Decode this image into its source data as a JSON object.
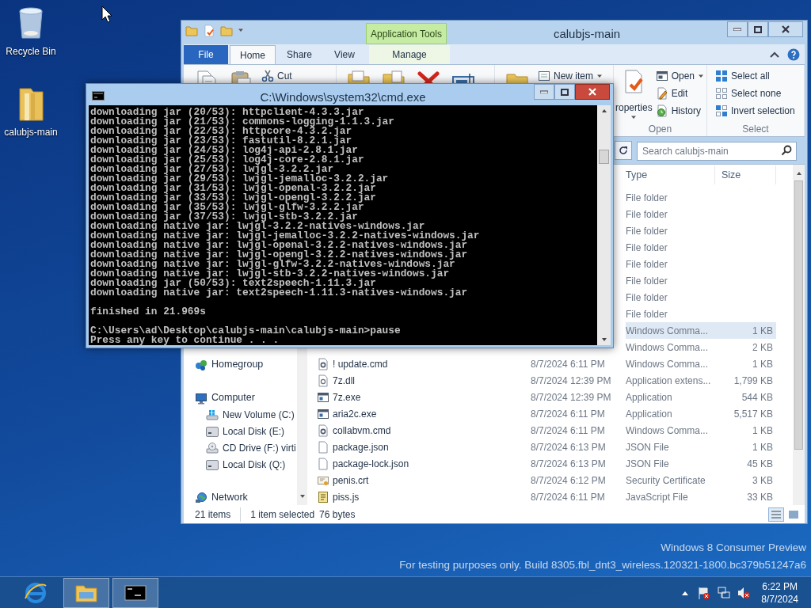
{
  "desktop": {
    "icons": [
      {
        "kind": "recycle",
        "label": "Recycle Bin"
      },
      {
        "kind": "folder",
        "label": "calubjs-main"
      }
    ],
    "watermark": [
      "Windows 8 Consumer Preview",
      "For testing purposes only. Build 8305.fbl_dnt3_wireless.120321-1800.bc379b51247a6"
    ]
  },
  "explorer": {
    "title": "calubjs-main",
    "context_group": "Application Tools",
    "tabs": [
      {
        "label": "File",
        "kind": "file",
        "selected": false
      },
      {
        "label": "Home",
        "kind": "tab",
        "selected": true
      },
      {
        "label": "Share",
        "kind": "tab",
        "selected": false
      },
      {
        "label": "View",
        "kind": "tab",
        "selected": false
      },
      {
        "label": "Manage",
        "kind": "context",
        "selected": false
      }
    ],
    "ribbon": [
      {
        "items": [
          {
            "kind": "copy"
          },
          {
            "kind": "paste"
          },
          {
            "kind": "cut",
            "label": "Cut"
          }
        ]
      },
      {
        "items": [
          {
            "kind": "move"
          },
          {
            "kind": "copy_to"
          },
          {
            "kind": "delete"
          },
          {
            "kind": "rename"
          }
        ]
      },
      {
        "items": [
          {
            "kind": "new_folder"
          },
          {
            "kind": "new_item",
            "label": "New item",
            "dropdown": true
          }
        ]
      },
      {
        "label": "Open",
        "items": [
          {
            "kind": "properties",
            "label": "roperties",
            "dropdown": true
          },
          {
            "kind": "open",
            "label": "Open",
            "dropdown": true
          },
          {
            "kind": "edit",
            "label": "Edit"
          },
          {
            "kind": "history",
            "label": "History"
          }
        ]
      },
      {
        "label": "Select",
        "items": [
          {
            "kind": "select_all",
            "label": "Select all"
          },
          {
            "kind": "select_none",
            "label": "Select none"
          },
          {
            "kind": "invert",
            "label": "Invert selection"
          }
        ]
      }
    ],
    "search": {
      "placeholder": "Search calubjs-main"
    },
    "navigation": [
      {
        "kind": "homegroup",
        "label": "Homegroup"
      },
      {
        "kind": "computer",
        "label": "Computer",
        "children": [
          {
            "kind": "drive_sys",
            "label": "New Volume (C:)"
          },
          {
            "kind": "drive",
            "label": "Local Disk (E:)"
          },
          {
            "kind": "cd",
            "label": "CD Drive (F:) virti"
          },
          {
            "kind": "drive",
            "label": "Local Disk (Q:)"
          }
        ]
      },
      {
        "kind": "network",
        "label": "Network"
      }
    ],
    "columns": [
      "Type",
      "Size"
    ],
    "rows": [
      {
        "type": "File folder",
        "selected": false
      },
      {
        "type": "File folder",
        "selected": false
      },
      {
        "type": "File folder",
        "selected": false
      },
      {
        "type": "File folder",
        "selected": false
      },
      {
        "type": "File folder",
        "selected": false
      },
      {
        "type": "File folder",
        "selected": false
      },
      {
        "type": "File folder",
        "selected": false
      },
      {
        "type": "File folder",
        "selected": false
      },
      {
        "type": "Windows Comma...",
        "size": "1 KB",
        "selected": true
      },
      {
        "type": "Windows Comma...",
        "size": "2 KB",
        "selected": false
      },
      {
        "kind": "cmd",
        "name": "! update.cmd",
        "date": "8/7/2024 6:11 PM",
        "type": "Windows Comma...",
        "size": "1 KB",
        "selected": false
      },
      {
        "kind": "dll",
        "name": "7z.dll",
        "date": "8/7/2024 12:39 PM",
        "type": "Application extens...",
        "size": "1,799 KB",
        "selected": false
      },
      {
        "kind": "exe",
        "name": "7z.exe",
        "date": "8/7/2024 12:39 PM",
        "type": "Application",
        "size": "544 KB",
        "selected": false
      },
      {
        "kind": "exe",
        "name": "aria2c.exe",
        "date": "8/7/2024 6:11 PM",
        "type": "Application",
        "size": "5,517 KB",
        "selected": false
      },
      {
        "kind": "cmd",
        "name": "collabvm.cmd",
        "date": "8/7/2024 6:11 PM",
        "type": "Windows Comma...",
        "size": "1 KB",
        "selected": false
      },
      {
        "kind": "json",
        "name": "package.json",
        "date": "8/7/2024 6:13 PM",
        "type": "JSON File",
        "size": "1 KB",
        "selected": false
      },
      {
        "kind": "json",
        "name": "package-lock.json",
        "date": "8/7/2024 6:13 PM",
        "type": "JSON File",
        "size": "45 KB",
        "selected": false
      },
      {
        "kind": "cert",
        "name": "penis.crt",
        "date": "8/7/2024 6:12 PM",
        "type": "Security Certificate",
        "size": "3 KB",
        "selected": false
      },
      {
        "kind": "js",
        "name": "piss.js",
        "date": "8/7/2024 6:11 PM",
        "type": "JavaScript File",
        "size": "33 KB",
        "selected": false
      }
    ],
    "status_bar": {
      "count": "21 items",
      "selection": "1 item selected",
      "size": "76 bytes"
    }
  },
  "console": {
    "title": "C:\\Windows\\system32\\cmd.exe",
    "blocks": [
      [
        "downloading jar (20/53): httpclient-4.3.3.jar",
        "downloading jar (21/53): commons-logging-1.1.3.jar",
        "downloading jar (22/53): httpcore-4.3.2.jar",
        "downloading jar (23/53): fastutil-8.2.1.jar",
        "downloading jar (24/53): log4j-api-2.8.1.jar",
        "downloading jar (25/53): log4j-core-2.8.1.jar",
        "downloading jar (27/53): lwjgl-3.2.2.jar",
        "downloading jar (29/53): lwjgl-jemalloc-3.2.2.jar",
        "downloading jar (31/53): lwjgl-openal-3.2.2.jar",
        "downloading jar (33/53): lwjgl-opengl-3.2.2.jar",
        "downloading jar (35/53): lwjgl-glfw-3.2.2.jar",
        "downloading jar (37/53): lwjgl-stb-3.2.2.jar",
        "downloading native jar: lwjgl-3.2.2-natives-windows.jar",
        "downloading native jar: lwjgl-jemalloc-3.2.2-natives-windows.jar",
        "downloading native jar: lwjgl-openal-3.2.2-natives-windows.jar",
        "downloading native jar: lwjgl-opengl-3.2.2-natives-windows.jar",
        "downloading native jar: lwjgl-glfw-3.2.2-natives-windows.jar",
        "downloading native jar: lwjgl-stb-3.2.2-natives-windows.jar",
        "downloading jar (50/53): text2speech-1.11.3.jar",
        "downloading native jar: text2speech-1.11.3-natives-windows.jar"
      ],
      [
        "finished in 21.969s"
      ],
      [
        "C:\\Users\\ad\\Desktop\\calubjs-main\\calubjs-main>pause",
        "Press any key to continue . . ."
      ]
    ]
  },
  "taskbar": {
    "apps": [
      {
        "kind": "browser",
        "active": false
      },
      {
        "kind": "explorer",
        "active": true
      },
      {
        "kind": "console",
        "active": true
      }
    ],
    "clock": {
      "time": "6:22 PM",
      "date": "8/7/2024"
    }
  }
}
